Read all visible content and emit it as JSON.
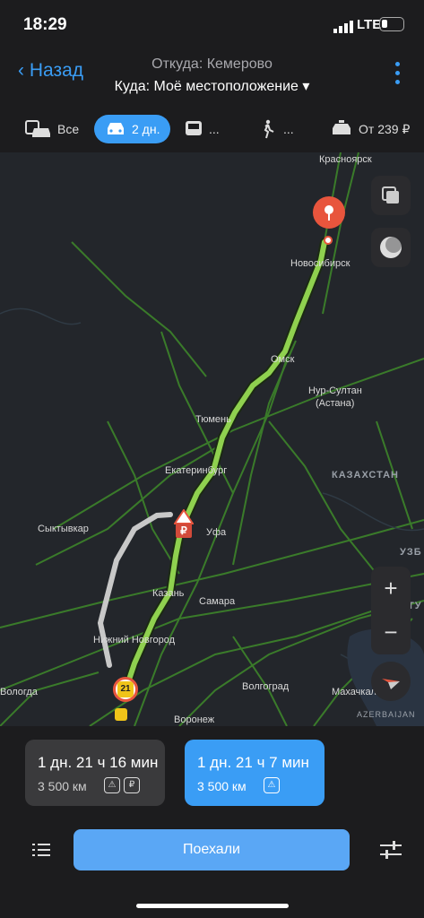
{
  "status": {
    "time": "18:29",
    "network": "LTE"
  },
  "header": {
    "back_label": "Назад",
    "from": "Откуда: Кемерово",
    "to": "Куда: Моё местоположение ▾"
  },
  "tabs": [
    {
      "label": "Все",
      "icon": "car-bus-icon"
    },
    {
      "label": "2 дн.",
      "icon": "car-icon",
      "selected": true
    },
    {
      "label": "...",
      "icon": "bus-icon"
    },
    {
      "label": "...",
      "icon": "walk-icon"
    },
    {
      "label": "От 239 ₽",
      "icon": "taxi-icon"
    }
  ],
  "map": {
    "cities": [
      "Красноярск",
      "Новосибирск",
      "Омск",
      "Нур-Султан",
      "(Астана)",
      "Тюмень",
      "Екатеринбург",
      "Уфа",
      "Сыктывкар",
      "Казань",
      "Самара",
      "Нижний Новгород",
      "Волгоград",
      "Махачкала",
      "Воронеж",
      "Вологда"
    ],
    "countries": [
      "КАЗАХСТАН",
      "УЗБ",
      "ТУ",
      "AZERBAIJAN"
    ],
    "zoom_in": "+",
    "zoom_out": "−",
    "markers": [
      "21",
      "₽"
    ]
  },
  "routes": [
    {
      "time": "1 дн. 21 ч 16 мин",
      "distance": "3 500 км",
      "badges": [
        "⚠",
        "₽"
      ],
      "selected": false
    },
    {
      "time": "1 дн. 21 ч 7 мин",
      "distance": "3 500 км",
      "badges": [
        "⚠"
      ],
      "selected": true
    }
  ],
  "go_button": "Поехали",
  "colors": {
    "accent": "#3a9df5",
    "route_active": "#8fd14f",
    "route_alt": "#c8c8c8",
    "destination_pin": "#e8553d"
  }
}
